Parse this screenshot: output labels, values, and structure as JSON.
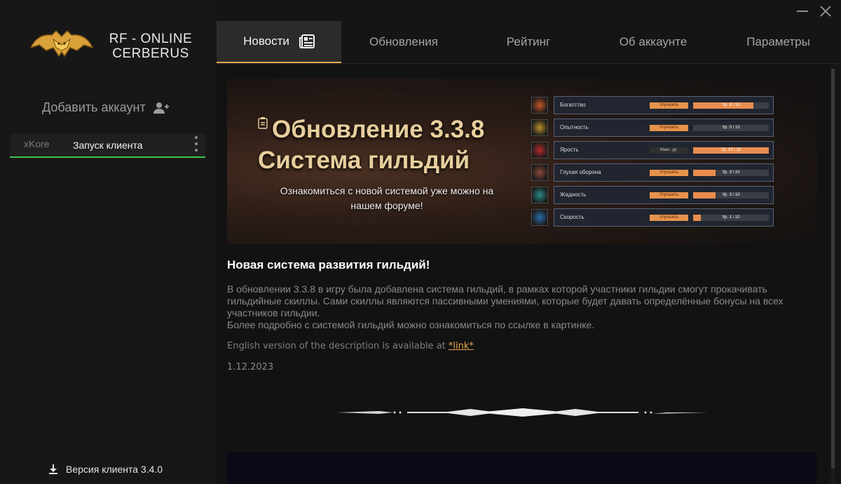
{
  "brand": {
    "line1": "RF - ONLINE",
    "line2": "CERBERUS"
  },
  "sidebar": {
    "add_account_label": "Добавить аккаунт",
    "accounts": [
      {
        "name": "xKore",
        "action": "Запуск клиента"
      }
    ],
    "version_label": "Версия клиента 3.4.0"
  },
  "tabs": [
    {
      "label": "Новости",
      "active": true
    },
    {
      "label": "Обновления",
      "active": false
    },
    {
      "label": "Рейтинг",
      "active": false
    },
    {
      "label": "Об аккаунте",
      "active": false
    },
    {
      "label": "Параметры",
      "active": false
    }
  ],
  "banner": {
    "title_line1": "Обновление 3.3.8",
    "title_line2": "Система гильдий",
    "subtitle": "Ознакомиться с новой системой уже можно на нашем форуме!",
    "skills": [
      {
        "name": "Богатство",
        "button": "Улучшить",
        "level": "Ур. 8 \\ 10",
        "progress": 0.8,
        "icon_color": "#c8552a",
        "icon": "coin-icon"
      },
      {
        "name": "Опытность",
        "button": "Улучшить",
        "level": "Ур. 0 \\ 10",
        "progress": 0.0,
        "icon_color": "#b8902a",
        "icon": "star-icon"
      },
      {
        "name": "Ярость",
        "button": "Макс. ур.",
        "level": "Ур. 10 \\ 10",
        "progress": 1.0,
        "icon_color": "#b22a2a",
        "icon": "sword-icon"
      },
      {
        "name": "Глухая оборона",
        "button": "Улучшить",
        "level": "Ур. 3 \\ 10",
        "progress": 0.3,
        "icon_color": "#8a4a3a",
        "icon": "shield-icon"
      },
      {
        "name": "Жадность",
        "button": "Улучшить",
        "level": "Ур. 3 \\ 10",
        "progress": 0.3,
        "icon_color": "#2a8a8a",
        "icon": "crystal-icon"
      },
      {
        "name": "Скорость",
        "button": "Улучшить",
        "level": "Ур. 1 \\ 10",
        "progress": 0.1,
        "icon_color": "#2a6aa8",
        "icon": "lightning-icon"
      }
    ]
  },
  "article": {
    "title": "Новая система развития гильдий!",
    "paragraph1": "В обновлении 3.3.8 в игру была добавлена система гильдий, в рамках которой участники гильдии смогут прокачивать гильдийные скиллы. Сами скиллы являются пассивными умениями, которые будет давать определённые бонусы на всех участников гильдии.",
    "paragraph2": "Более подробно с системой гильдий можно ознакомиться по ссылке в картинке.",
    "english_prefix": "English version of the description is available at",
    "english_link": "*link*",
    "date": "1.12.2023"
  },
  "colors": {
    "accent": "#e8a54f",
    "account_active": "#3fc54a",
    "background": "#151515"
  }
}
